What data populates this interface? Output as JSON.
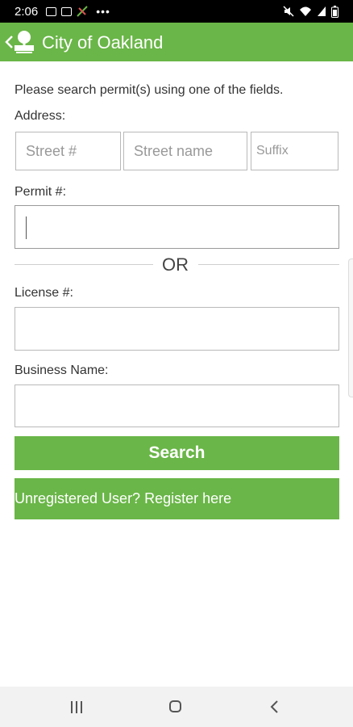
{
  "status_bar": {
    "time": "2:06",
    "overflow": "•••",
    "left_icons": [
      "image-icon",
      "message-icon",
      "no-signal-icon"
    ],
    "right_icons": [
      "mute-icon",
      "wifi-icon",
      "signal-icon",
      "battery-icon"
    ]
  },
  "app_bar": {
    "title": "City of Oakland",
    "back_icon": "chevron-left-icon",
    "logo_icon": "oakland-building-logo-icon",
    "accent_color": "#6ab648"
  },
  "form": {
    "instructions": "Please search permit(s) using one of the fields.",
    "address_label": "Address:",
    "street_number_placeholder": "Street #",
    "street_name_placeholder": "Street name",
    "suffix_placeholder": "Suffix",
    "permit_label": "Permit #:",
    "permit_value": "",
    "or_divider": "OR",
    "license_label": "License #:",
    "license_value": "",
    "business_label": "Business Name:",
    "business_value": ""
  },
  "buttons": {
    "search_label": "Search",
    "register_label": "Unregistered User? Register here"
  },
  "nav_bar": {
    "icons": [
      "recents-icon",
      "home-icon",
      "back-icon"
    ]
  }
}
